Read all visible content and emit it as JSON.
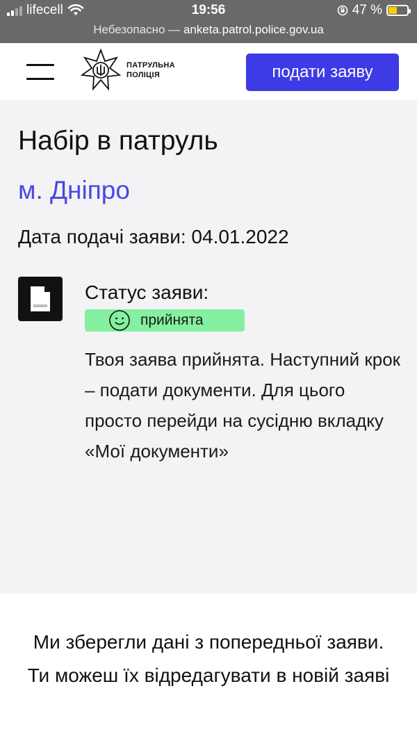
{
  "status_bar": {
    "carrier": "lifecell",
    "time": "19:56",
    "battery_percent": "47 %",
    "battery_level": 0.47,
    "url_prefix": "Небезопасно — ",
    "url_host": "anketa.patrol.police.gov.ua",
    "icons": [
      "signal-icon",
      "wifi-icon",
      "orientation-lock-icon",
      "battery-charging-icon"
    ]
  },
  "header": {
    "menu_icon": "hamburger-menu-icon",
    "logo_line1": "ПАТРУЛЬНА",
    "logo_line2": "ПОЛІЦІЯ",
    "cta_label": "подати заяву",
    "cta_color": "#3d3be6"
  },
  "application": {
    "title": "Набір в патруль",
    "city": "м. Дніпро",
    "city_color": "#4a47e3",
    "date_text": "Дата подачі заяви: 04.01.2022",
    "status_label": "Статус заяви:",
    "status_badge": "прийнята",
    "status_badge_color": "#84f0a0",
    "status_icon": "smile-icon",
    "document_icon": "document-icon",
    "description": "Твоя заява прийнята. Наступний крок – подати документи. Для цього просто перейди на сусідню вкладку «Мої документи»"
  },
  "footer": {
    "note": "Ми зберегли дані з попередньої заяви. Ти можеш їх відредагувати в новій заяві"
  }
}
